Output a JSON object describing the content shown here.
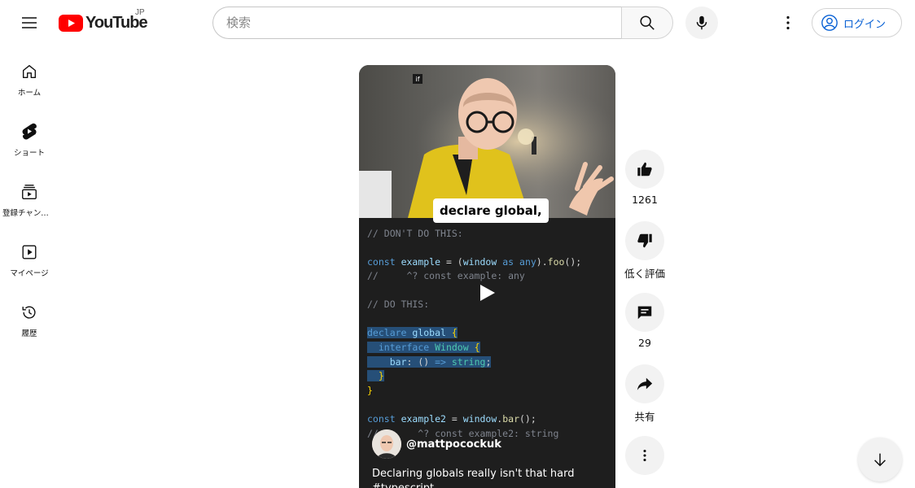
{
  "header": {
    "logo_text": "YouTube",
    "country_code": "JP",
    "search_placeholder": "検索",
    "login_label": "ログイン"
  },
  "guide": {
    "items": [
      {
        "label": "ホーム",
        "icon": "home-icon"
      },
      {
        "label": "ショート",
        "icon": "shorts-icon"
      },
      {
        "label": "登録チャンネル",
        "icon": "subscriptions-icon"
      },
      {
        "label": "マイページ",
        "icon": "you-icon"
      },
      {
        "label": "履歴",
        "icon": "history-icon"
      }
    ]
  },
  "short": {
    "caption": "declare global,",
    "badge": "if",
    "code": [
      "// DON'T DO THIS:",
      "const example = (window as any).foo();",
      "//     ^? const example: any",
      "// DO THIS:",
      "declare global {",
      "  interface Window {",
      "    bar: () => string;",
      "  }",
      "}",
      "const example2 = window.bar();",
      "//       ^? const example2: string"
    ],
    "channel_handle": "@mattpocockuk",
    "title": "Declaring globals really isn't that hard #typescript"
  },
  "actions": {
    "like_count": "1261",
    "dislike_label": "低く評価",
    "comment_count": "29",
    "share_label": "共有"
  },
  "colors": {
    "brand_red": "#ff0000",
    "link_blue": "#065fd4",
    "button_bg": "#f2f2f2"
  }
}
